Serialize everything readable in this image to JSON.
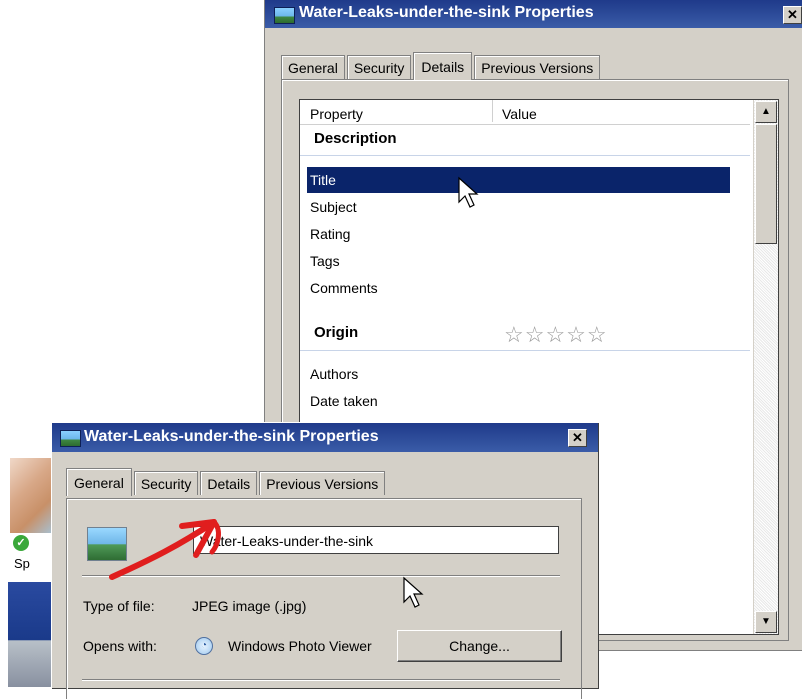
{
  "back_dialog": {
    "title": "Water-Leaks-under-the-sink Properties",
    "close_glyph": "✕",
    "tabs": [
      "General",
      "Security",
      "Details",
      "Previous Versions"
    ],
    "active_tab": "Details",
    "columns": {
      "property": "Property",
      "value": "Value"
    },
    "groups": {
      "description": "Description",
      "origin": "Origin"
    },
    "rows": [
      "Title",
      "Subject",
      "Rating",
      "Tags",
      "Comments",
      "Authors",
      "Date taken"
    ],
    "selected_row": "Title",
    "rating_stars": "☆☆☆☆☆",
    "rating_value": 0,
    "scroll_up_glyph": "▲",
    "scroll_down_glyph": "▼"
  },
  "front_dialog": {
    "title": "Water-Leaks-under-the-sink Properties",
    "close_glyph": "✕",
    "tabs": [
      "General",
      "Security",
      "Details",
      "Previous Versions"
    ],
    "active_tab": "General",
    "file_name": "Water-Leaks-under-the-sink",
    "type_label": "Type of file:",
    "type_value": "JPEG image (.jpg)",
    "opens_label": "Opens with:",
    "opens_value": "Windows Photo Viewer",
    "change_button": "Change..."
  },
  "desktop": {
    "item_label": "Sp"
  },
  "icons": [
    "window-icon",
    "image-file-icon",
    "photo-viewer-icon",
    "check-badge-icon",
    "mouse-cursor-icon",
    "red-arrow-annotation"
  ],
  "colors": {
    "titlebar": "#1f3a8a",
    "selection": "#0a246a",
    "dialog_bg": "#d4d0c8",
    "annotation": "#e01e1e"
  }
}
